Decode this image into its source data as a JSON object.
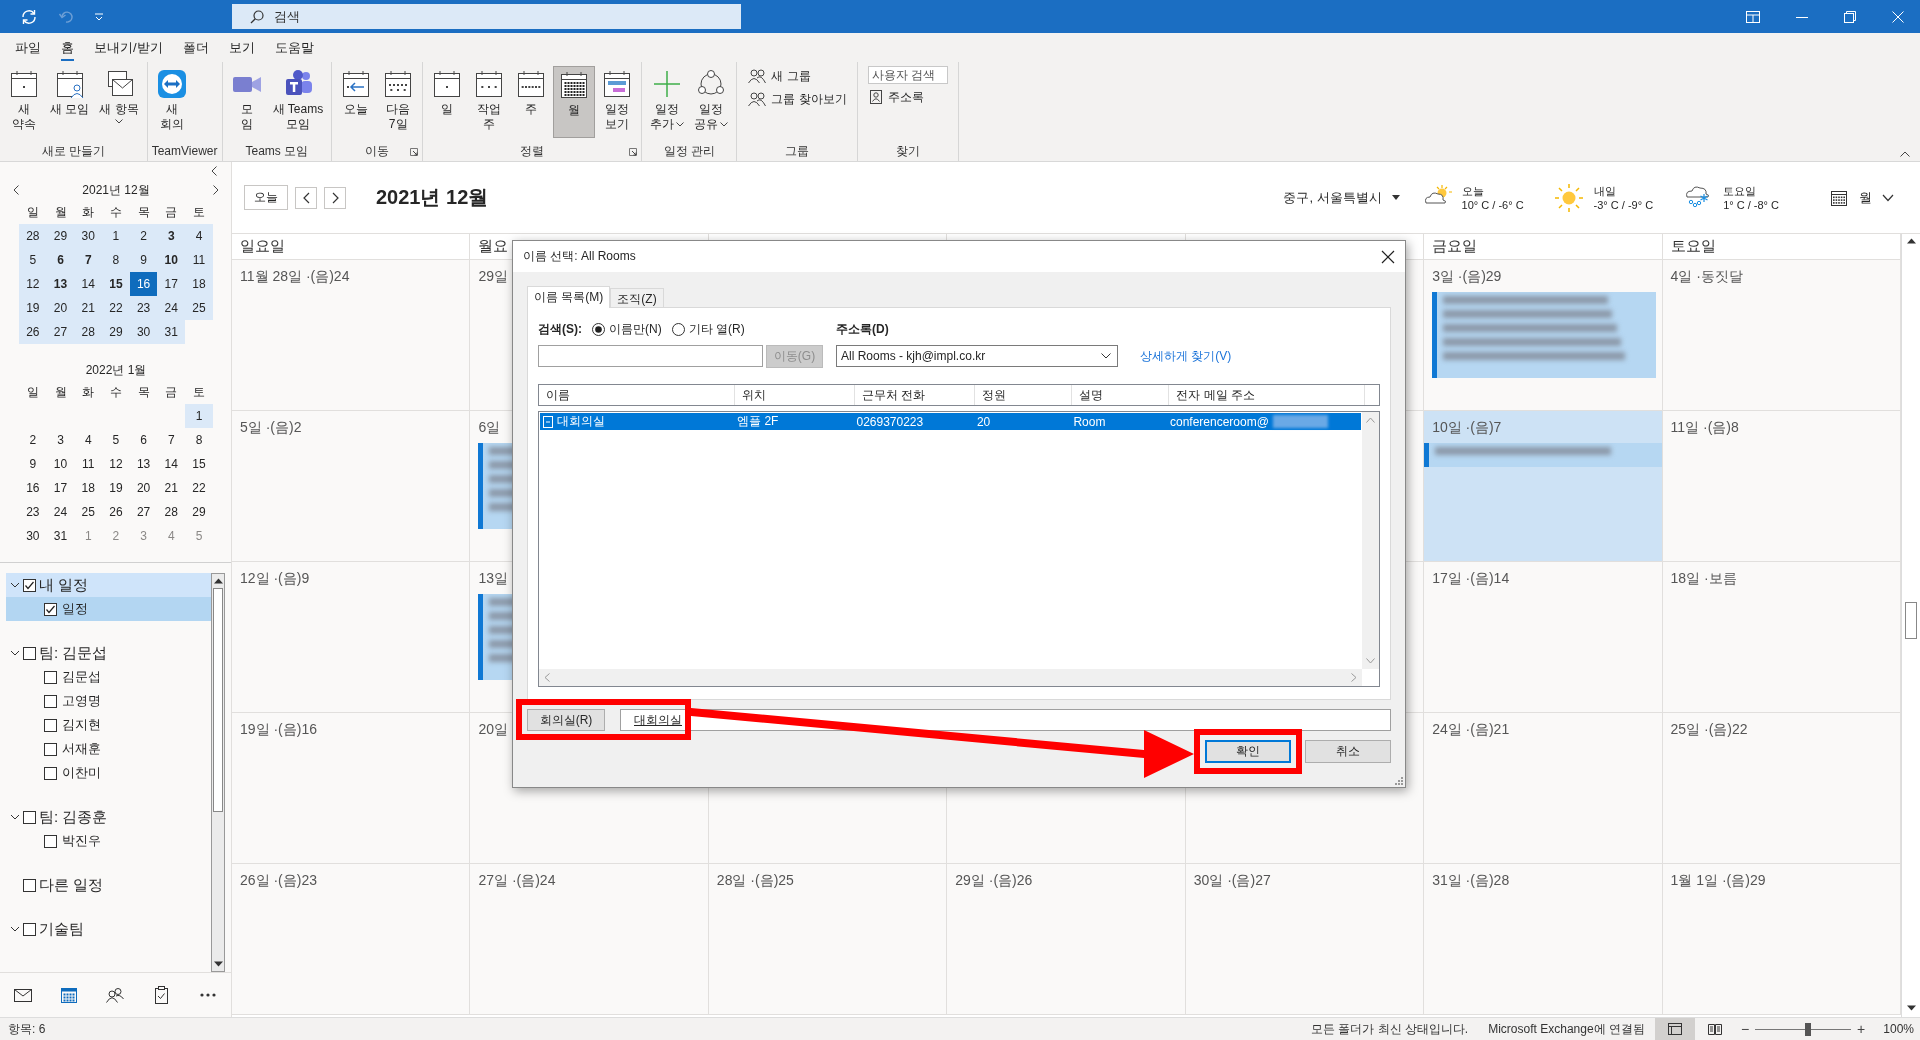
{
  "title_bar": {
    "search": {
      "placeholder": "검색"
    }
  },
  "menu_tabs": [
    {
      "label": "파일",
      "selected": false
    },
    {
      "label": "홈",
      "selected": true
    },
    {
      "label": "보내기/받기",
      "selected": false
    },
    {
      "label": "폴더",
      "selected": false
    },
    {
      "label": "보기",
      "selected": false
    },
    {
      "label": "도움말",
      "selected": false
    }
  ],
  "ribbon": {
    "groups": [
      {
        "label": "새로 만들기",
        "launcher": false,
        "items": [
          {
            "kind": "large",
            "label": "새\n약속",
            "menu": false,
            "selected": false
          },
          {
            "kind": "large",
            "label": "새 모임",
            "menu": false,
            "selected": false
          },
          {
            "kind": "large",
            "label": "새 항목",
            "menu": true,
            "selected": false
          }
        ]
      },
      {
        "label": "TeamViewer",
        "launcher": false,
        "items": [
          {
            "kind": "large",
            "label": "새\n회의",
            "menu": false,
            "selected": false
          }
        ]
      },
      {
        "label": "Teams 모임",
        "launcher": false,
        "items": [
          {
            "kind": "large",
            "label": "모\n임",
            "menu": false,
            "selected": false
          },
          {
            "kind": "large",
            "label": "새 Teams\n모임",
            "menu": false,
            "selected": false
          }
        ]
      },
      {
        "label": "이동",
        "launcher": true,
        "items": [
          {
            "kind": "large",
            "label": "오늘",
            "menu": false,
            "selected": false
          },
          {
            "kind": "large",
            "label": "다음\n7일",
            "menu": false,
            "selected": false
          }
        ]
      },
      {
        "label": "정렬",
        "launcher": true,
        "items": [
          {
            "kind": "large",
            "label": "일",
            "menu": false,
            "selected": false
          },
          {
            "kind": "large",
            "label": "작업\n주",
            "menu": false,
            "selected": false
          },
          {
            "kind": "large",
            "label": "주",
            "menu": false,
            "selected": false
          },
          {
            "kind": "large",
            "label": "월",
            "menu": false,
            "selected": true
          },
          {
            "kind": "large",
            "label": "일정\n보기",
            "menu": false,
            "selected": false
          }
        ]
      },
      {
        "label": "일정 관리",
        "launcher": false,
        "items": [
          {
            "kind": "large",
            "label": "일정\n추가",
            "menu": true,
            "selected": false
          },
          {
            "kind": "large",
            "label": "일정\n공유",
            "menu": true,
            "selected": false
          }
        ]
      },
      {
        "label": "그룹",
        "launcher": false,
        "items": [
          {
            "kind": "small",
            "label": "새 그룹",
            "menu": false,
            "selected": false
          },
          {
            "kind": "small",
            "label": "그룹 찾아보기",
            "menu": false,
            "selected": false
          }
        ]
      },
      {
        "label": "찾기",
        "launcher": false,
        "items": [
          {
            "kind": "field",
            "placeholder": "사용자 검색"
          },
          {
            "kind": "small",
            "label": "주소록",
            "menu": false,
            "selected": false
          }
        ]
      }
    ]
  },
  "mini_calendars": [
    {
      "title": "2021년 12월",
      "weekdays": [
        "일",
        "월",
        "화",
        "수",
        "목",
        "금",
        "토"
      ],
      "weeks": [
        [
          {
            "d": "28",
            "bold": false,
            "selected": false,
            "shaded": true,
            "dim": false
          },
          {
            "d": "29",
            "bold": false,
            "selected": false,
            "shaded": true,
            "dim": false
          },
          {
            "d": "30",
            "bold": false,
            "selected": false,
            "shaded": true,
            "dim": false
          },
          {
            "d": "1",
            "bold": false,
            "selected": false,
            "shaded": true,
            "dim": false
          },
          {
            "d": "2",
            "bold": false,
            "selected": false,
            "shaded": true,
            "dim": false
          },
          {
            "d": "3",
            "bold": true,
            "selected": false,
            "shaded": true,
            "dim": false
          },
          {
            "d": "4",
            "bold": false,
            "selected": false,
            "shaded": true,
            "dim": false
          }
        ],
        [
          {
            "d": "5",
            "bold": false,
            "selected": false,
            "shaded": true,
            "dim": false
          },
          {
            "d": "6",
            "bold": true,
            "selected": false,
            "shaded": true,
            "dim": false
          },
          {
            "d": "7",
            "bold": true,
            "selected": false,
            "shaded": true,
            "dim": false
          },
          {
            "d": "8",
            "bold": false,
            "selected": false,
            "shaded": true,
            "dim": false
          },
          {
            "d": "9",
            "bold": false,
            "selected": false,
            "shaded": true,
            "dim": false
          },
          {
            "d": "10",
            "bold": true,
            "selected": false,
            "shaded": true,
            "dim": false
          },
          {
            "d": "11",
            "bold": false,
            "selected": false,
            "shaded": true,
            "dim": false
          }
        ],
        [
          {
            "d": "12",
            "bold": false,
            "selected": false,
            "shaded": true,
            "dim": false
          },
          {
            "d": "13",
            "bold": true,
            "selected": false,
            "shaded": true,
            "dim": false
          },
          {
            "d": "14",
            "bold": false,
            "selected": false,
            "shaded": true,
            "dim": false
          },
          {
            "d": "15",
            "bold": true,
            "selected": false,
            "shaded": true,
            "dim": false
          },
          {
            "d": "16",
            "bold": false,
            "selected": true,
            "shaded": true,
            "dim": false
          },
          {
            "d": "17",
            "bold": false,
            "selected": false,
            "shaded": true,
            "dim": false
          },
          {
            "d": "18",
            "bold": false,
            "selected": false,
            "shaded": true,
            "dim": false
          }
        ],
        [
          {
            "d": "19",
            "bold": false,
            "selected": false,
            "shaded": true,
            "dim": false
          },
          {
            "d": "20",
            "bold": false,
            "selected": false,
            "shaded": true,
            "dim": false
          },
          {
            "d": "21",
            "bold": false,
            "selected": false,
            "shaded": true,
            "dim": false
          },
          {
            "d": "22",
            "bold": false,
            "selected": false,
            "shaded": true,
            "dim": false
          },
          {
            "d": "23",
            "bold": false,
            "selected": false,
            "shaded": true,
            "dim": false
          },
          {
            "d": "24",
            "bold": false,
            "selected": false,
            "shaded": true,
            "dim": false
          },
          {
            "d": "25",
            "bold": false,
            "selected": false,
            "shaded": true,
            "dim": false
          }
        ],
        [
          {
            "d": "26",
            "bold": false,
            "selected": false,
            "shaded": true,
            "dim": false
          },
          {
            "d": "27",
            "bold": false,
            "selected": false,
            "shaded": true,
            "dim": false
          },
          {
            "d": "28",
            "bold": false,
            "selected": false,
            "shaded": true,
            "dim": false
          },
          {
            "d": "29",
            "bold": false,
            "selected": false,
            "shaded": true,
            "dim": false
          },
          {
            "d": "30",
            "bold": false,
            "selected": false,
            "shaded": true,
            "dim": false
          },
          {
            "d": "31",
            "bold": false,
            "selected": false,
            "shaded": true,
            "dim": false
          }
        ]
      ]
    },
    {
      "title": "2022년 1월",
      "weekdays": [
        "일",
        "월",
        "화",
        "수",
        "목",
        "금",
        "토"
      ],
      "weeks": [
        [
          {
            "d": "1",
            "bold": false,
            "selected": false,
            "shaded": true,
            "dim": false
          }
        ],
        [
          {
            "d": "2",
            "bold": false,
            "selected": false,
            "shaded": false,
            "dim": false
          },
          {
            "d": "3",
            "bold": false,
            "selected": false,
            "shaded": false,
            "dim": false
          },
          {
            "d": "4",
            "bold": false,
            "selected": false,
            "shaded": false,
            "dim": false
          },
          {
            "d": "5",
            "bold": false,
            "selected": false,
            "shaded": false,
            "dim": false
          },
          {
            "d": "6",
            "bold": false,
            "selected": false,
            "shaded": false,
            "dim": false
          },
          {
            "d": "7",
            "bold": false,
            "selected": false,
            "shaded": false,
            "dim": false
          },
          {
            "d": "8",
            "bold": false,
            "selected": false,
            "shaded": false,
            "dim": false
          }
        ],
        [
          {
            "d": "9",
            "bold": false,
            "selected": false,
            "shaded": false,
            "dim": false
          },
          {
            "d": "10",
            "bold": false,
            "selected": false,
            "shaded": false,
            "dim": false
          },
          {
            "d": "11",
            "bold": false,
            "selected": false,
            "shaded": false,
            "dim": false
          },
          {
            "d": "12",
            "bold": false,
            "selected": false,
            "shaded": false,
            "dim": false
          },
          {
            "d": "13",
            "bold": false,
            "selected": false,
            "shaded": false,
            "dim": false
          },
          {
            "d": "14",
            "bold": false,
            "selected": false,
            "shaded": false,
            "dim": false
          },
          {
            "d": "15",
            "bold": false,
            "selected": false,
            "shaded": false,
            "dim": false
          }
        ],
        [
          {
            "d": "16",
            "bold": false,
            "selected": false,
            "shaded": false,
            "dim": false
          },
          {
            "d": "17",
            "bold": false,
            "selected": false,
            "shaded": false,
            "dim": false
          },
          {
            "d": "18",
            "bold": false,
            "selected": false,
            "shaded": false,
            "dim": false
          },
          {
            "d": "19",
            "bold": false,
            "selected": false,
            "shaded": false,
            "dim": false
          },
          {
            "d": "20",
            "bold": false,
            "selected": false,
            "shaded": false,
            "dim": false
          },
          {
            "d": "21",
            "bold": false,
            "selected": false,
            "shaded": false,
            "dim": false
          },
          {
            "d": "22",
            "bold": false,
            "selected": false,
            "shaded": false,
            "dim": false
          }
        ],
        [
          {
            "d": "23",
            "bold": false,
            "selected": false,
            "shaded": false,
            "dim": false
          },
          {
            "d": "24",
            "bold": false,
            "selected": false,
            "shaded": false,
            "dim": false
          },
          {
            "d": "25",
            "bold": false,
            "selected": false,
            "shaded": false,
            "dim": false
          },
          {
            "d": "26",
            "bold": false,
            "selected": false,
            "shaded": false,
            "dim": false
          },
          {
            "d": "27",
            "bold": false,
            "selected": false,
            "shaded": false,
            "dim": false
          },
          {
            "d": "28",
            "bold": false,
            "selected": false,
            "shaded": false,
            "dim": false
          },
          {
            "d": "29",
            "bold": false,
            "selected": false,
            "shaded": false,
            "dim": false
          }
        ],
        [
          {
            "d": "30",
            "bold": false,
            "selected": false,
            "shaded": false,
            "dim": false
          },
          {
            "d": "31",
            "bold": false,
            "selected": false,
            "shaded": false,
            "dim": false
          },
          {
            "d": "1",
            "bold": false,
            "selected": false,
            "shaded": false,
            "dim": true
          },
          {
            "d": "2",
            "bold": false,
            "selected": false,
            "shaded": false,
            "dim": true
          },
          {
            "d": "3",
            "bold": false,
            "selected": false,
            "shaded": false,
            "dim": true
          },
          {
            "d": "4",
            "bold": false,
            "selected": false,
            "shaded": false,
            "dim": true
          },
          {
            "d": "5",
            "bold": false,
            "selected": false,
            "shaded": false,
            "dim": true
          }
        ]
      ]
    }
  ],
  "folders": [
    {
      "label": "내 일정",
      "kind": "group",
      "expanded": true,
      "checked": true,
      "selected": true,
      "children": [
        {
          "label": "일정",
          "checked": true,
          "selected": true
        }
      ]
    },
    {
      "label": "팀: 김문섭",
      "kind": "group",
      "expanded": true,
      "checked": false,
      "selected": false,
      "children": [
        {
          "label": "김문섭",
          "checked": false,
          "selected": false
        },
        {
          "label": "고영명",
          "checked": false,
          "selected": false
        },
        {
          "label": "김지현",
          "checked": false,
          "selected": false
        },
        {
          "label": "서재훈",
          "checked": false,
          "selected": false
        },
        {
          "label": "이찬미",
          "checked": false,
          "selected": false
        }
      ]
    },
    {
      "label": "팀: 김종훈",
      "kind": "group",
      "expanded": true,
      "checked": false,
      "selected": false,
      "children": [
        {
          "label": "박진우",
          "checked": false,
          "selected": false
        }
      ]
    },
    {
      "label": "다른 일정",
      "kind": "plain",
      "checked": false,
      "selected": false
    },
    {
      "label": "기술팀",
      "kind": "group",
      "expanded": true,
      "checked": false,
      "selected": false
    }
  ],
  "nav_items": [
    {
      "selected": false
    },
    {
      "selected": true
    },
    {
      "selected": false
    },
    {
      "selected": false
    },
    {
      "selected": false
    }
  ],
  "calendar": {
    "today_button": "오늘",
    "title": "2021년 12월",
    "location": "중구, 서울특별시",
    "weather": [
      {
        "kind": "partly_sunny",
        "day": "오늘",
        "temps": "10° C / -6° C"
      },
      {
        "kind": "sunny",
        "day": "내일",
        "temps": "-3° C / -9° C"
      },
      {
        "kind": "snow",
        "day": "토요일",
        "temps": "1° C / -8° C"
      }
    ],
    "view": "월",
    "weekdays": {
      "start": [
        "일요일",
        "월요"
      ],
      "end": [
        "금요일",
        "토요일"
      ]
    },
    "weeks": [
      {
        "start": [
          {
            "date": "11월 28일 ·(음)24"
          },
          {
            "date": "29일"
          }
        ],
        "end": [
          {
            "date": "3일 ·(음)29",
            "event": {
              "kind": "tall"
            }
          },
          {
            "date": "4일 ·동짓달"
          }
        ]
      },
      {
        "start": [
          {
            "date": "5일 ·(음)2"
          },
          {
            "date": "6일",
            "event": {
              "kind": "tall"
            }
          }
        ],
        "end": [
          {
            "date": "10일 ·(음)7",
            "event": {
              "kind": "allday"
            }
          },
          {
            "date": "11일 ·(음)8"
          }
        ]
      },
      {
        "start": [
          {
            "date": "12일 ·(음)9"
          },
          {
            "date": "13일",
            "event": {
              "kind": "tall"
            }
          }
        ],
        "end": [
          {
            "date": "17일 ·(음)14"
          },
          {
            "date": "18일 ·보름"
          }
        ]
      },
      {
        "start": [
          {
            "date": "19일 ·(음)16"
          },
          {
            "date": "20일"
          }
        ],
        "end": [
          {
            "date": "24일 ·(음)21"
          },
          {
            "date": "25일 ·(음)22"
          }
        ]
      },
      {
        "cells": [
          {
            "date": "26일 ·(음)23"
          },
          {
            "date": "27일 ·(음)24"
          },
          {
            "date": "28일 ·(음)25"
          },
          {
            "date": "29일 ·(음)26"
          },
          {
            "date": "30일 ·(음)27"
          },
          {
            "date": "31일 ·(음)28"
          },
          {
            "date": "1월 1일 ·(음)29"
          }
        ]
      }
    ]
  },
  "dialog": {
    "title": "이름 선택: All Rooms",
    "tabs": [
      {
        "label": "이름 목록(M)",
        "selected": true
      },
      {
        "label": "조직(Z)",
        "selected": false
      }
    ],
    "search_label": "검색(S):",
    "search_modes": [
      {
        "label": "이름만(N)",
        "selected": true
      },
      {
        "label": "기타 열(R)",
        "selected": false
      }
    ],
    "go_button": {
      "label": "이동(G)",
      "disabled": true
    },
    "address_book_label": "주소록(D)",
    "address_book": {
      "value": "All Rooms - kjh@impl.co.kr"
    },
    "advanced_link": "상세하게 찾기(V)",
    "columns": [
      "이름",
      "위치",
      "근무처 전화",
      "정원",
      "설명",
      "전자 메일 주소"
    ],
    "rows": [
      {
        "cells": [
          "대회의실",
          "엠플 2F",
          "0269370223",
          "20",
          "Room",
          "conferenceroom@"
        ],
        "selected": true,
        "redacted": true
      }
    ],
    "rooms_button": "회의실(R)",
    "rooms": {
      "value": "대회의실",
      "marked": true
    },
    "buttons": [
      {
        "label": "확인",
        "default": true,
        "marked": true
      },
      {
        "label": "취소",
        "default": false,
        "marked": false
      }
    ],
    "arrow": true
  },
  "status_bar": {
    "items_count": "항목: 6",
    "sync": "모든 폴더가 최신 상태입니다.",
    "connection": "Microsoft Exchange에 연결됨",
    "views": [
      {
        "selected": true
      },
      {
        "selected": false
      }
    ],
    "zoom": {
      "minus": "−",
      "plus": "+",
      "level": 0.55,
      "reading": "100%"
    }
  }
}
